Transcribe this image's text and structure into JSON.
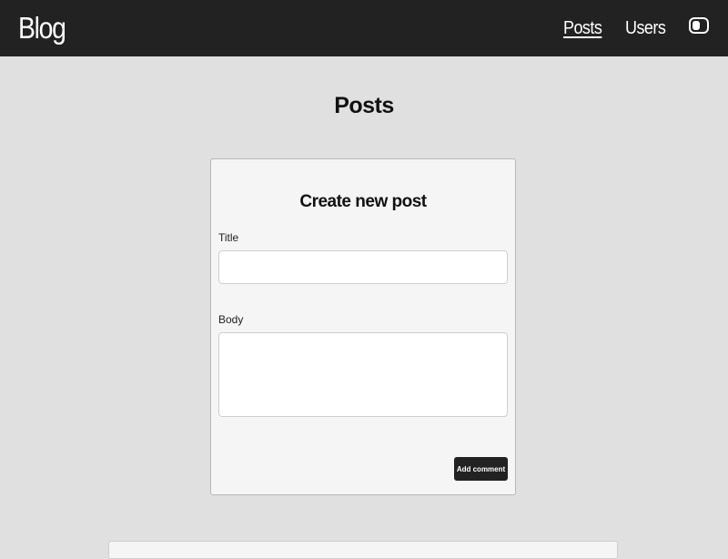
{
  "header": {
    "brand": "Blog",
    "nav": {
      "posts": "Posts",
      "users": "Users"
    },
    "active_nav": "Posts",
    "theme_toggle_icon": "toggle-switch-icon"
  },
  "main": {
    "title": "Posts"
  },
  "create_post_form": {
    "heading": "Create new post",
    "title_label": "Title",
    "title_value": "",
    "body_label": "Body",
    "body_value": "",
    "submit_label": "Add comment"
  },
  "colors": {
    "header_bg": "#222222",
    "page_bg": "#e0e0e0",
    "card_bg": "#f5f5f5",
    "button_bg": "#222222"
  }
}
